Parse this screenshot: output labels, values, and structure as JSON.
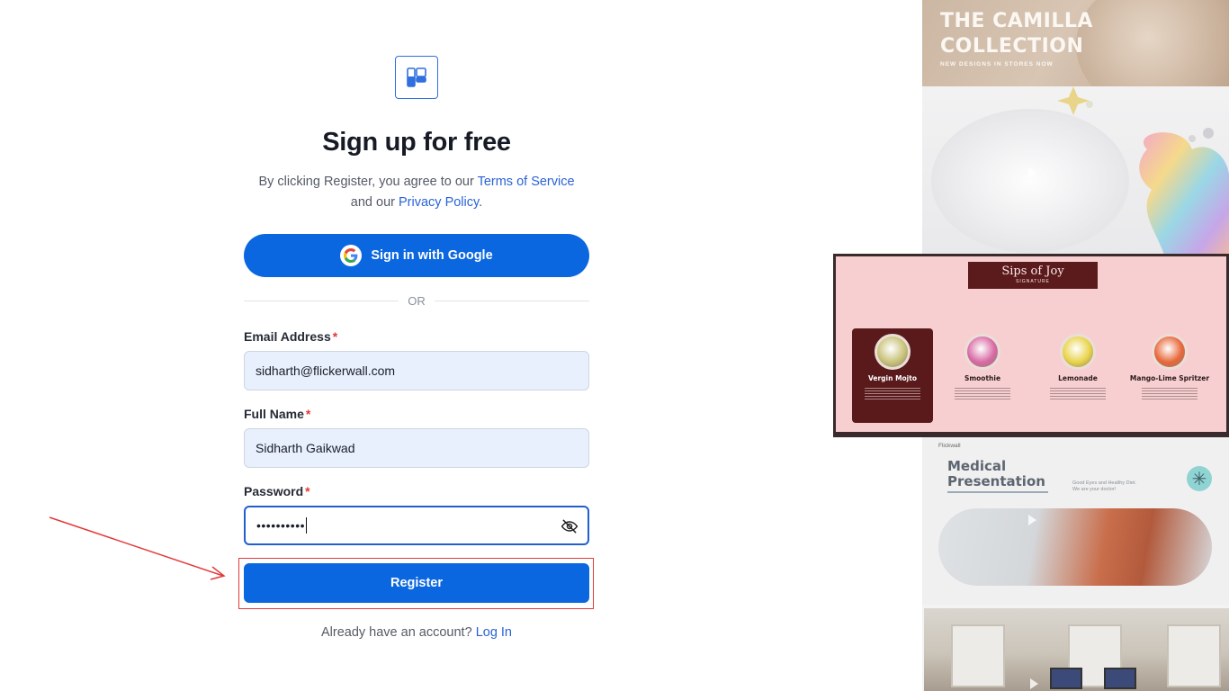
{
  "form": {
    "title": "Sign up for free",
    "terms_prefix": "By clicking Register, you agree to our ",
    "terms_link": "Terms of Service",
    "terms_middle": "and our ",
    "privacy_link": "Privacy Policy",
    "terms_suffix": ".",
    "google_button": "Sign in with Google",
    "or_text": "OR",
    "email_label": "Email Address",
    "email_value": "sidharth@flickerwall.com",
    "fullname_label": "Full Name",
    "fullname_value": "Sidharth Gaikwad",
    "password_label": "Password",
    "password_value": "••••••••••",
    "required_mark": "*",
    "register_button": "Register",
    "login_prompt": "Already have an account? ",
    "login_link": "Log In"
  },
  "templates": {
    "camilla": {
      "title_line1": "THE CAMILLA",
      "title_line2": "COLLECTION",
      "subtitle": "NEW DESIGNS IN STORES NOW"
    },
    "sips": {
      "title": "Sips of Joy",
      "subtitle": "SIGNATURE",
      "drinks": [
        {
          "name": "Vergin Mojto",
          "color": "#c9c27a"
        },
        {
          "name": "Smoothie",
          "color": "#d86aa4"
        },
        {
          "name": "Lemonade",
          "color": "#e9d34a"
        },
        {
          "name": "Mango-Lime Spritzer",
          "color": "#e8683a"
        }
      ]
    },
    "medical": {
      "brand": "Flickwall",
      "title_line1": "Medical",
      "title_line2": "Presentation",
      "text": "Good Eyes and Healthy Diet. We are your doctor!"
    }
  },
  "colors": {
    "primary": "#0b67e0",
    "link": "#2a63d6",
    "required": "#e03a3a",
    "highlight": "#e23a3a"
  }
}
